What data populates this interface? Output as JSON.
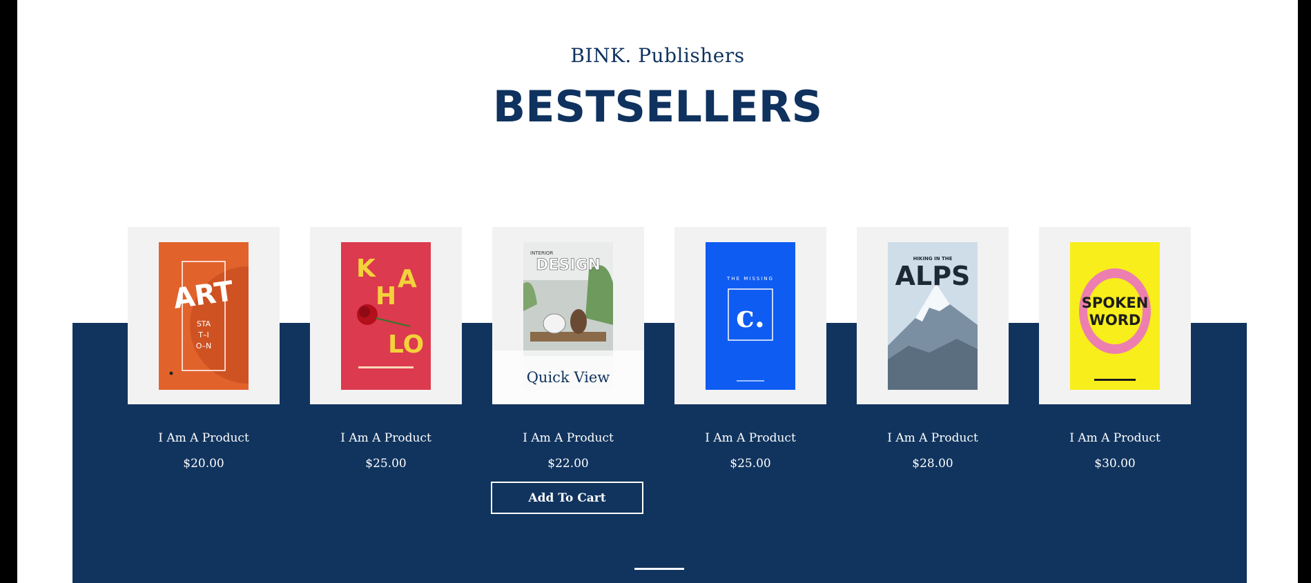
{
  "brand": "BINK. Publishers",
  "title": "BESTSELLERS",
  "quick_view_label": "Quick View",
  "add_to_cart_label": "Add To Cart",
  "colors": {
    "navy": "#11345e",
    "white": "#ffffff",
    "thumb_bg": "#f2f2f2"
  },
  "products": [
    {
      "name": "I Am A Product",
      "price": "$20.00",
      "cover": {
        "title": "ART",
        "subtitle": "STA T-I O-N",
        "bg": "#e2622c"
      }
    },
    {
      "name": "I Am A Product",
      "price": "$25.00",
      "cover": {
        "title": "K H A LO",
        "subtitle": "",
        "bg": "#dc3a4e"
      }
    },
    {
      "name": "I Am A Product",
      "price": "$22.00",
      "cover": {
        "title": "DESIGN",
        "subtitle": "INTERIOR",
        "bg": "#e9ecea"
      }
    },
    {
      "name": "I Am A Product",
      "price": "$25.00",
      "cover": {
        "title": "c.",
        "subtitle": "THE MISSING",
        "bg": "#0f5cf2"
      }
    },
    {
      "name": "I Am A Product",
      "price": "$28.00",
      "cover": {
        "title": "ALPS",
        "subtitle": "HIKING IN THE",
        "bg": "#a9c3d8"
      }
    },
    {
      "name": "I Am A Product",
      "price": "$30.00",
      "cover": {
        "title": "SPOKEN WORD",
        "subtitle": "",
        "bg": "#f8ee1b"
      }
    }
  ]
}
